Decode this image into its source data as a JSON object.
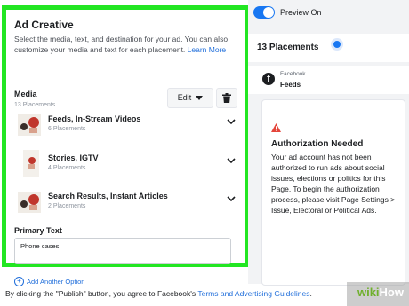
{
  "ad_creative": {
    "title": "Ad Creative",
    "description": "Select the media, text, and destination for your ad. You can also customize your media and text for each placement.",
    "learn_more": "Learn More"
  },
  "media": {
    "title": "Media",
    "count": "13 Placements",
    "edit_label": "Edit",
    "items": [
      {
        "title": "Feeds, In-Stream Videos",
        "sub": "6 Placements"
      },
      {
        "title": "Stories, IGTV",
        "sub": "4 Placements"
      },
      {
        "title": "Search Results, Instant Articles",
        "sub": "2 Placements"
      }
    ]
  },
  "primary_text": {
    "label": "Primary Text",
    "value": "Phone cases"
  },
  "add_option": "Add Another Option",
  "preview": {
    "toggle_label": "Preview On",
    "placements_title": "13 Placements",
    "platform": "Facebook",
    "placement": "Feeds"
  },
  "auth": {
    "title": "Authorization Needed",
    "body": "Your ad account has not been authorized to run ads about social issues, elections or politics for this Page. To begin the authorization process, please visit Page Settings > Issue, Electoral or Political Ads."
  },
  "footer": {
    "prefix": "By clicking the \"Publish\" button, you agree to Facebook's",
    "terms": "Terms and Advertising Guidelines",
    "suffix": "."
  },
  "watermark": {
    "wiki": "wiki",
    "how": "How"
  },
  "colors": {
    "highlight": "#22e622",
    "accent": "#1877f2",
    "link": "#216fdb",
    "warning": "#e4453b"
  }
}
